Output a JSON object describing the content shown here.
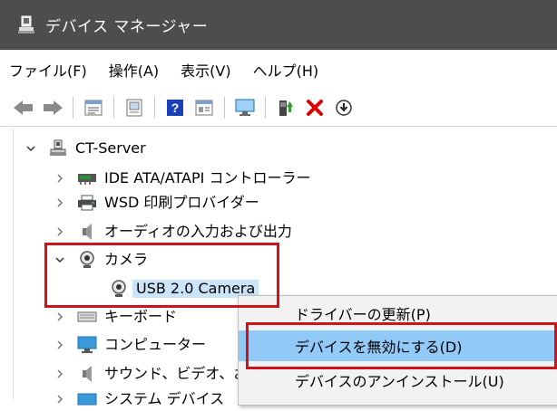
{
  "window": {
    "title": "デバイス マネージャー"
  },
  "menu": [
    "ファイル(F)",
    "操作(A)",
    "表示(V)",
    "ヘルプ(H)"
  ],
  "toolbar": {
    "icons": [
      "back-arrow-icon",
      "forward-arrow-icon",
      "properties-icon",
      "show-hidden-icon",
      "help-icon",
      "view-icon",
      "monitor-icon",
      "update-driver-icon",
      "uninstall-x-icon",
      "download-circle-icon"
    ],
    "colors": {
      "uninstall": "#e00000",
      "help": "#1a3fb8"
    }
  },
  "tree": {
    "root": "CT-Server",
    "items": [
      {
        "label": "IDE ATA/ATAPI コントローラー",
        "expanded": false,
        "icon": "ide-controller-icon"
      },
      {
        "label": "WSD 印刷プロバイダー",
        "expanded": false,
        "icon": "printer-icon"
      },
      {
        "label": "オーディオの入力および出力",
        "expanded": false,
        "icon": "speaker-icon"
      },
      {
        "label": "カメラ",
        "expanded": true,
        "icon": "camera-icon"
      },
      {
        "label": "USB 2.0 Camera",
        "child": true,
        "selected": true,
        "icon": "webcam-icon"
      },
      {
        "label": "キーボード",
        "expanded": false,
        "icon": "keyboard-icon"
      },
      {
        "label": "コンピューター",
        "expanded": false,
        "icon": "computer-icon"
      },
      {
        "label": "サウンド、ビデオ、およ",
        "expanded": false,
        "icon": "sound-icon"
      },
      {
        "label": "システム デバイス",
        "expanded": false,
        "icon": "system-device-icon"
      }
    ]
  },
  "context_menu": {
    "items": [
      {
        "label": "ドライバーの更新(P)",
        "highlighted": false
      },
      {
        "label": "デバイスを無効にする(D)",
        "highlighted": true
      },
      {
        "label": "デバイスのアンインストール(U)",
        "highlighted": false
      }
    ]
  },
  "colors": {
    "titlebar": "#4d4d4d",
    "selection": "#cce4f7",
    "menu_highlight": "#91c9f7",
    "annotation": "#d0121b"
  }
}
